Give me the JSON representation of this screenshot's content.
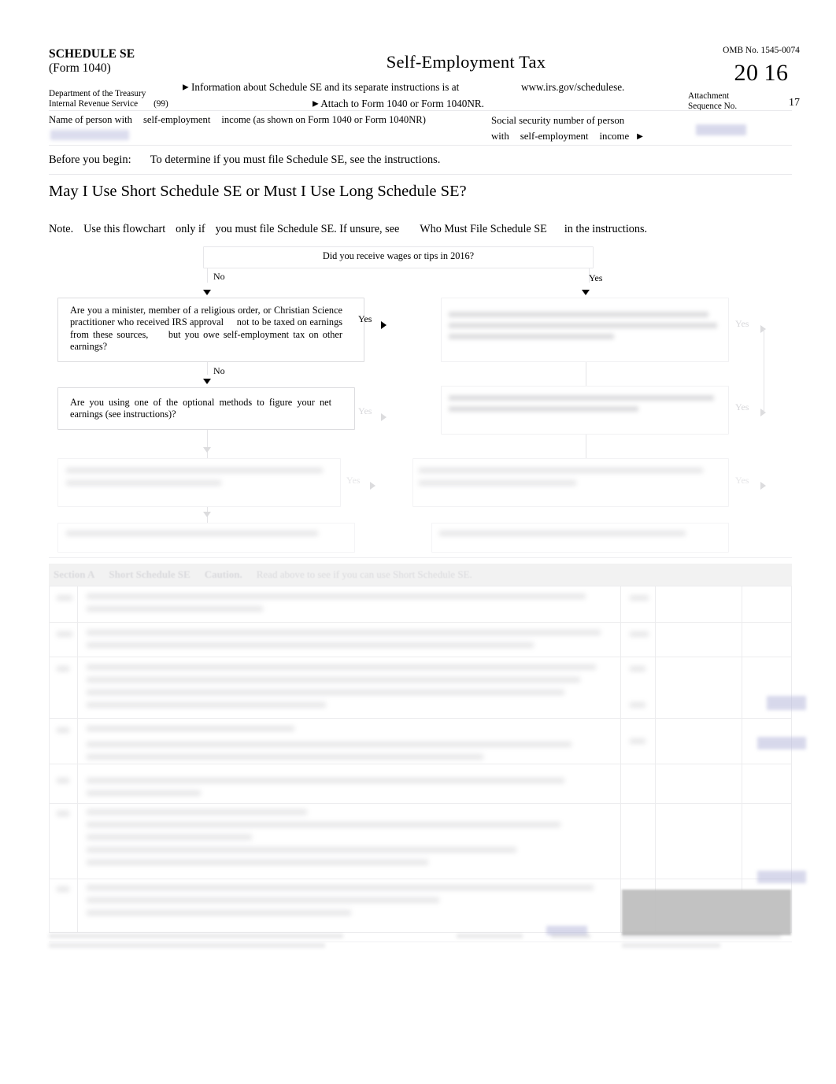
{
  "document": {
    "form_id": "SCHEDULE SE",
    "form_parent": "(Form 1040)",
    "title": "Self-Employment Tax",
    "department_line1": "Department of the Treasury",
    "department_line2": "Internal Revenue Service",
    "department_code": "(99)",
    "information_line": "Information about Schedule SE and its separate instructions is at",
    "information_url": "www.irs.gov/schedulese.",
    "attach_line": "Attach to Form 1040 or Form 1040NR.",
    "omb": "OMB No. 1545-0074",
    "year_part1": "20",
    "year_part2": "16",
    "attachment_label_line1": "Attachment",
    "attachment_label_line2": "Sequence No.",
    "attachment_sequence": "17",
    "arrow_glyph": "▶"
  },
  "identity": {
    "name_label_part1": "Name of person with",
    "name_label_part2": "self-employment",
    "name_label_part3": "income (as shown on Form 1040 or Form 1040NR)",
    "name_value": "",
    "ssn_label_line1": "Social security number of person",
    "ssn_label_line2_a": "with",
    "ssn_label_line2_b": "self-employment",
    "ssn_label_line2_c": "income",
    "ssn_value": ""
  },
  "before": {
    "label": "Before you begin:",
    "text": "To determine if you must file Schedule SE, see the instructions."
  },
  "flowchart_heading": "May I Use Short Schedule SE or Must I Use Long Schedule SE?",
  "note": {
    "lead": "Note.",
    "part1": "Use this flowchart",
    "part2": "only if",
    "part3": "you must file Schedule SE. If unsure, see",
    "part4": "Who Must File Schedule SE",
    "part5": "in the instructions."
  },
  "flowchart": {
    "top_question": "Did you receive wages or tips in 2016?",
    "label_no": "No",
    "label_yes": "Yes",
    "box_minister": "Are you a minister, member of a religious order, or Christian Science practitioner who received IRS approval not to be taxed on earnings from these sources, but you owe self-employment tax on other earnings?",
    "box_minister_seg": [
      "Are  you  a  minister,  member  of  a  religious  order,  or  Christian",
      "Science practitioner who received IRS approval",
      "not  to be taxed",
      "on earnings from these sources,",
      "but  you owe self-employment",
      "tax on other earnings?"
    ],
    "box_optional": "Are you using one of the optional methods to figure your net earnings (see instructions)?",
    "box_optional_seg": [
      "Are  you  using  one  of  the  optional  methods  to  figure  your  net",
      "earnings (see instructions)?"
    ],
    "illegible_boxes_note": "remaining flowchart boxes are faded beyond legibility in the source image"
  },
  "section_a": {
    "label": "Section A",
    "title": "Short Schedule SE",
    "caution": "Caution.",
    "instruction": "Read above to see if you can use Short Schedule SE."
  },
  "lower_form": {
    "legibility": "The numbered line items, captions and amount columns of Section A are faded to near-white in the source screenshot and are not legible.",
    "line_numbers": [
      "1a",
      "1b",
      "2",
      "3",
      "4",
      "5",
      "6"
    ],
    "redacted_amount_cells": 3,
    "gray_block_present": true
  },
  "colors": {
    "page_background": "#ffffff",
    "rule": "#e9e9ec",
    "redaction_fill": "#b8badc",
    "gray_block": "#bfbfbf",
    "faded_text": "#d8d8db"
  }
}
